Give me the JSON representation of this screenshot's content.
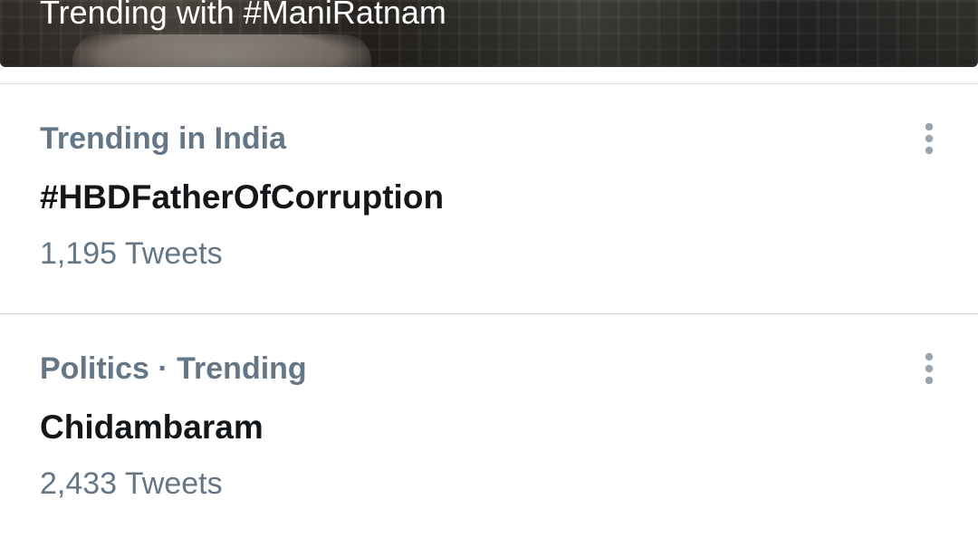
{
  "banner": {
    "title": "Trending with #ManiRatnam"
  },
  "trends": [
    {
      "context": "Trending in India",
      "name": "#HBDFatherOfCorruption",
      "count": "1,195 Tweets",
      "menu_icon": "more-vertical-icon"
    },
    {
      "context": "Politics · Trending",
      "name": "Chidambaram",
      "count": "2,433 Tweets",
      "menu_icon": "more-vertical-icon"
    }
  ],
  "colors": {
    "secondary_text": "#657786",
    "primary_text": "#14171a",
    "divider": "#d9dee2",
    "icon": "#9aa5ae"
  }
}
